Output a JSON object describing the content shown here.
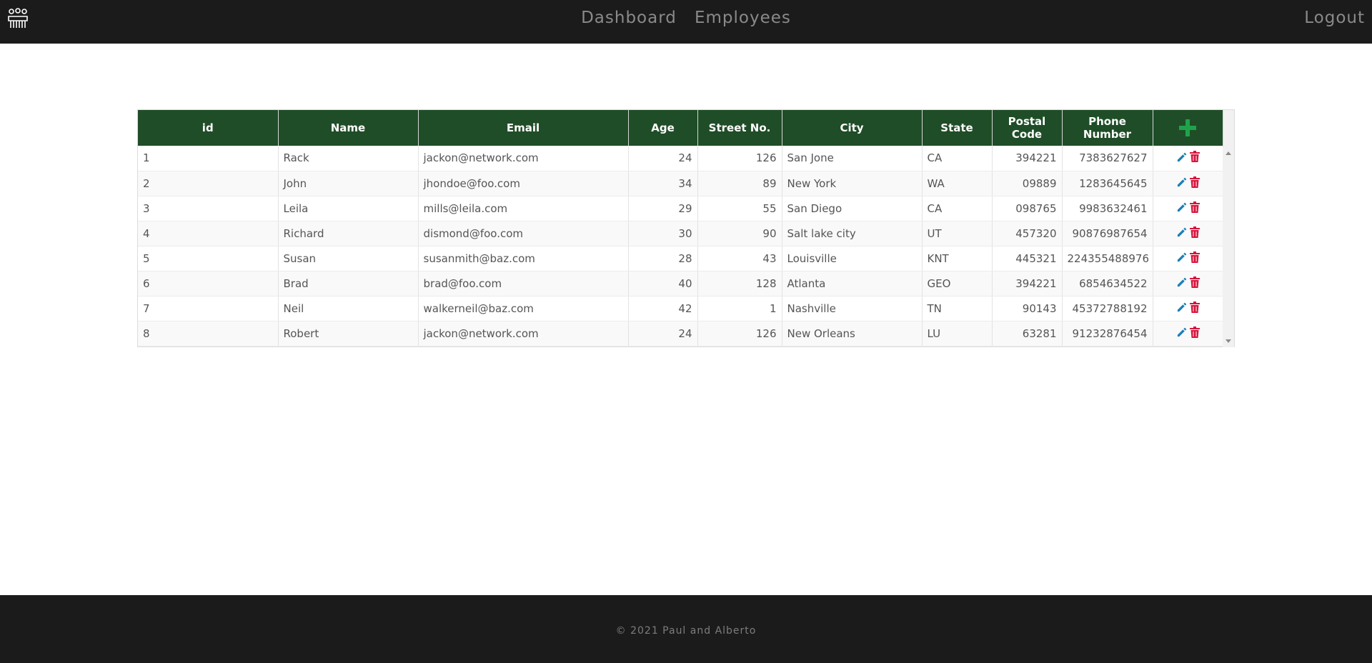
{
  "nav": {
    "links": [
      "Dashboard",
      "Employees"
    ],
    "logout": "Logout",
    "logo_icon": "team-icon"
  },
  "table": {
    "headers": {
      "id": "id",
      "name": "Name",
      "email": "Email",
      "age": "Age",
      "street": "Street No.",
      "city": "City",
      "state": "State",
      "postal_l1": "Postal",
      "postal_l2": "Code",
      "phone_l1": "Phone",
      "phone_l2": "Number"
    },
    "add_icon": "plus-icon",
    "rows": [
      {
        "id": "1",
        "name": "Rack",
        "email": "jackon@network.com",
        "age": "24",
        "street": "126",
        "city": "San Jone",
        "state": "CA",
        "postal": "394221",
        "phone": "7383627627"
      },
      {
        "id": "2",
        "name": "John",
        "email": "jhondoe@foo.com",
        "age": "34",
        "street": "89",
        "city": "New York",
        "state": "WA",
        "postal": "09889",
        "phone": "1283645645"
      },
      {
        "id": "3",
        "name": "Leila",
        "email": "mills@leila.com",
        "age": "29",
        "street": "55",
        "city": "San Diego",
        "state": "CA",
        "postal": "098765",
        "phone": "9983632461"
      },
      {
        "id": "4",
        "name": "Richard",
        "email": "dismond@foo.com",
        "age": "30",
        "street": "90",
        "city": "Salt lake city",
        "state": "UT",
        "postal": "457320",
        "phone": "90876987654"
      },
      {
        "id": "5",
        "name": "Susan",
        "email": "susanmith@baz.com",
        "age": "28",
        "street": "43",
        "city": "Louisville",
        "state": "KNT",
        "postal": "445321",
        "phone": "224355488976"
      },
      {
        "id": "6",
        "name": "Brad",
        "email": "brad@foo.com",
        "age": "40",
        "street": "128",
        "city": "Atlanta",
        "state": "GEO",
        "postal": "394221",
        "phone": "6854634522"
      },
      {
        "id": "7",
        "name": "Neil",
        "email": "walkerneil@baz.com",
        "age": "42",
        "street": "1",
        "city": "Nashville",
        "state": "TN",
        "postal": "90143",
        "phone": "45372788192"
      },
      {
        "id": "8",
        "name": "Robert",
        "email": "jackon@network.com",
        "age": "24",
        "street": "126",
        "city": "New Orleans",
        "state": "LU",
        "postal": "63281",
        "phone": "91232876454"
      }
    ],
    "edit_icon": "pencil-icon",
    "delete_icon": "trash-icon"
  },
  "colors": {
    "header_bg": "#1f4d27",
    "add_green": "#1fa34a",
    "edit_blue": "#1a7fb5",
    "delete_red": "#d8143c",
    "bar_bg": "#1b1b1b"
  },
  "footer": {
    "copyright": "© 2021 Paul and Alberto"
  }
}
